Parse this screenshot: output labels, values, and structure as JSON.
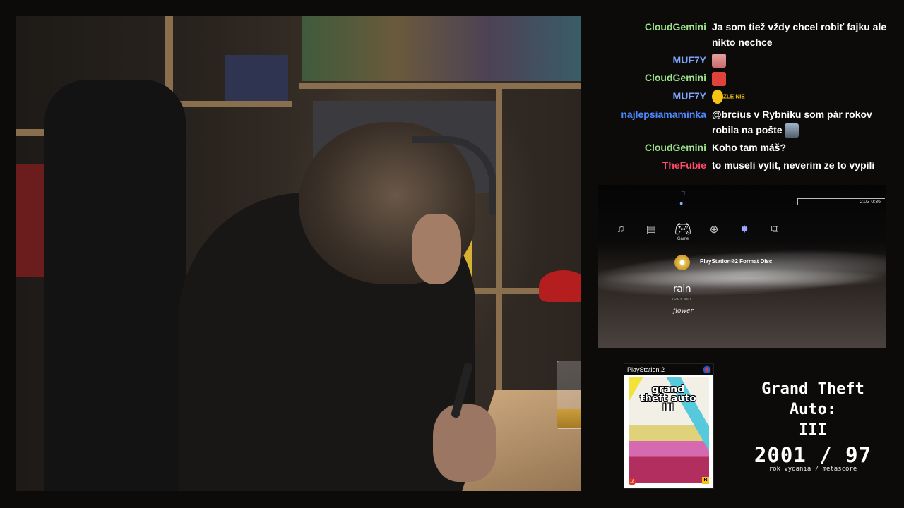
{
  "chat": {
    "messages": [
      {
        "author": "CloudGemini",
        "color": "#9be38a",
        "text": "Ja som tiež vždy chcel robiť fajku ale nikto nechce"
      },
      {
        "author": "MUF7Y",
        "color": "#7aa6ff",
        "text": "",
        "emote": "face-emote"
      },
      {
        "author": "CloudGemini",
        "color": "#9be38a",
        "text": "",
        "emote": "angry-emote"
      },
      {
        "author": "MUF7Y",
        "color": "#7aa6ff",
        "text": "",
        "emote": "zle-emote",
        "emote_text": "ZLE NIE"
      },
      {
        "author": "najlepsiamaminka",
        "color": "#4d88ff",
        "text": "@brcius v Rybníku som pár rokov robila na pošte",
        "emote": "avatar-emote"
      },
      {
        "author": "CloudGemini",
        "color": "#9be38a",
        "text": "Koho tam máš?"
      },
      {
        "author": "TheFubie",
        "color": "#ff4a6a",
        "text": "to museli vylit, neverim ze to vypili"
      }
    ]
  },
  "xmb": {
    "clock": "21/3 0:36",
    "categories": [
      "music-icon",
      "video-icon",
      "game-icon",
      "network-icon",
      "psn-icon",
      "friends-icon"
    ],
    "selected_category_label": "Game",
    "items": {
      "disc_label": "PlayStation®2 Format Disc",
      "rain_title": "rain",
      "rain_subtitle": "JOURNEY",
      "flower_title": "flower"
    }
  },
  "cover": {
    "platform": "PlayStation.2",
    "logo_text": "grand theft auto III",
    "rating": "18"
  },
  "game": {
    "title_line1": "Grand Theft",
    "title_line2": "Auto:",
    "title_line3": "III",
    "year": "2001",
    "separator": "/",
    "metascore": "97",
    "caption": "rok vydania / metascore"
  }
}
